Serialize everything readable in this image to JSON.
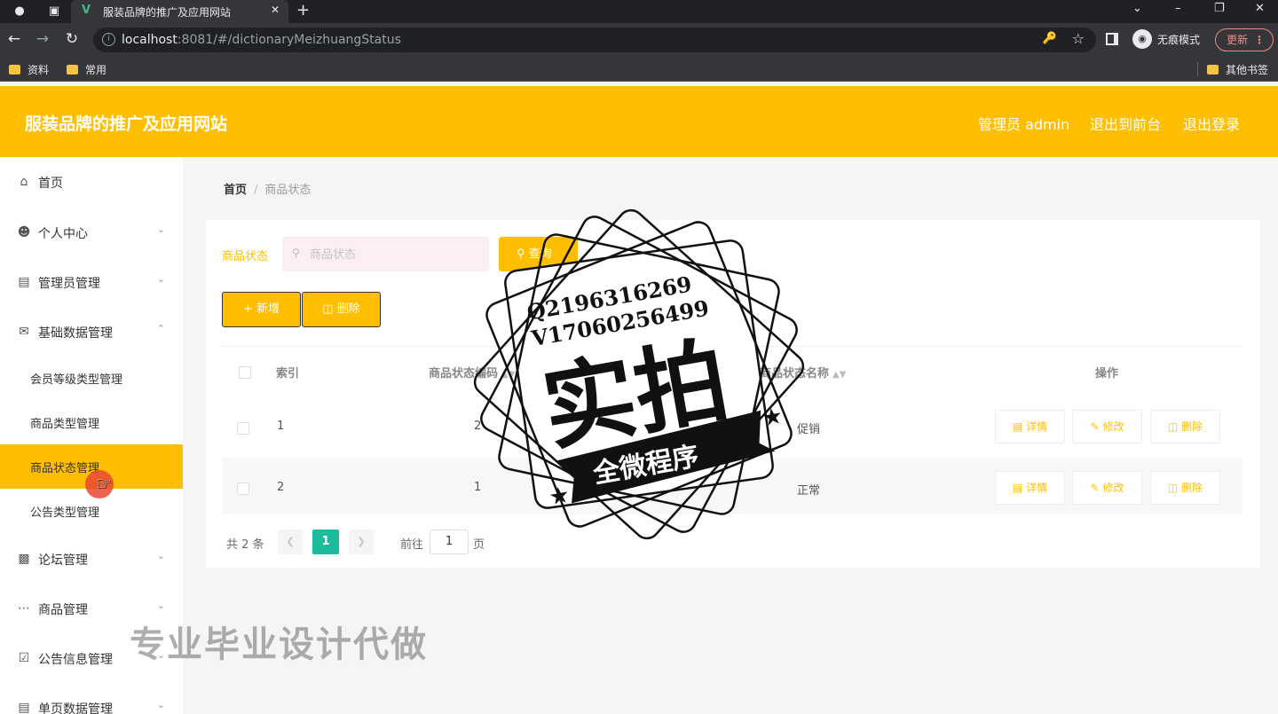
{
  "browser": {
    "tab_title": "服装品牌的推广及应用网站",
    "url_host": "localhost",
    "url_path": ":8081/#/dictionaryMeizhuangStatus",
    "incognito_label": "无痕模式",
    "update_label": "更新",
    "bookmarks": [
      "资料",
      "常用"
    ],
    "other_bookmarks": "其他书签"
  },
  "header": {
    "site_title": "服装品牌的推广及应用网站",
    "admin_label": "管理员 admin",
    "back_to_front": "退出到前台",
    "logout": "退出登录",
    "accent_color": "#ffbf00"
  },
  "sidebar": {
    "items": [
      {
        "label": "首页",
        "icon": "home-icon"
      },
      {
        "label": "个人中心",
        "icon": "user-icon"
      },
      {
        "label": "管理员管理",
        "icon": "briefcase-icon"
      },
      {
        "label": "基础数据管理",
        "icon": "mail-icon"
      },
      {
        "label": "论坛管理",
        "icon": "clipboard-icon"
      },
      {
        "label": "商品管理",
        "icon": "chat-icon"
      },
      {
        "label": "公告信息管理",
        "icon": "checklist-icon"
      },
      {
        "label": "单页数据管理",
        "icon": "server-icon"
      }
    ],
    "sub_items": [
      "会员等级类型管理",
      "商品类型管理",
      "商品状态管理",
      "公告类型管理"
    ]
  },
  "breadcrumb": {
    "home": "首页",
    "current": "商品状态"
  },
  "search": {
    "label": "商品状态",
    "placeholder": "商品状态",
    "query_label": "查询"
  },
  "actions": {
    "add_label": "新增",
    "delete_label": "删除"
  },
  "table": {
    "columns": [
      "索引",
      "商品状态编码",
      "商品状态名称",
      "操作"
    ],
    "rows": [
      {
        "index": "1",
        "code": "2",
        "name": "促销"
      },
      {
        "index": "2",
        "code": "1",
        "name": "正常"
      }
    ],
    "row_actions": {
      "detail": "详情",
      "edit": "修改",
      "delete": "删除"
    }
  },
  "pagination": {
    "total_text": "共 2 条",
    "current_page": "1",
    "goto_label": "前往",
    "goto_value": "1",
    "page_suffix": "页"
  },
  "overlay": {
    "stamp_line1": "Q2196316269",
    "stamp_line2": "V17060256499",
    "stamp_big": "实拍",
    "stamp_ribbon": "全微程序",
    "watermark": "专业毕业设计代做"
  }
}
